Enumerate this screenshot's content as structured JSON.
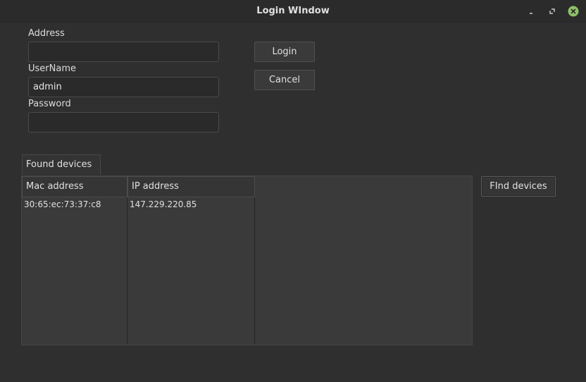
{
  "window": {
    "title": "Login WIndow",
    "controls": {
      "minimize_icon": "minimize-icon",
      "maximize_icon": "maximize-icon",
      "close_icon": "close-icon",
      "close_color": "#8fc26a"
    }
  },
  "form": {
    "address_label": "Address",
    "address_value": "",
    "username_label": "UserName",
    "username_value": "admin",
    "password_label": "Password",
    "password_value": ""
  },
  "actions": {
    "login_label": "Login",
    "cancel_label": "Cancel",
    "find_label": "FInd devices"
  },
  "devices": {
    "tab_label": "Found devices",
    "columns": [
      "Mac address",
      "IP address"
    ],
    "rows": [
      {
        "mac": "30:65:ec:73:37:c8",
        "ip": "147.229.220.85"
      }
    ]
  }
}
